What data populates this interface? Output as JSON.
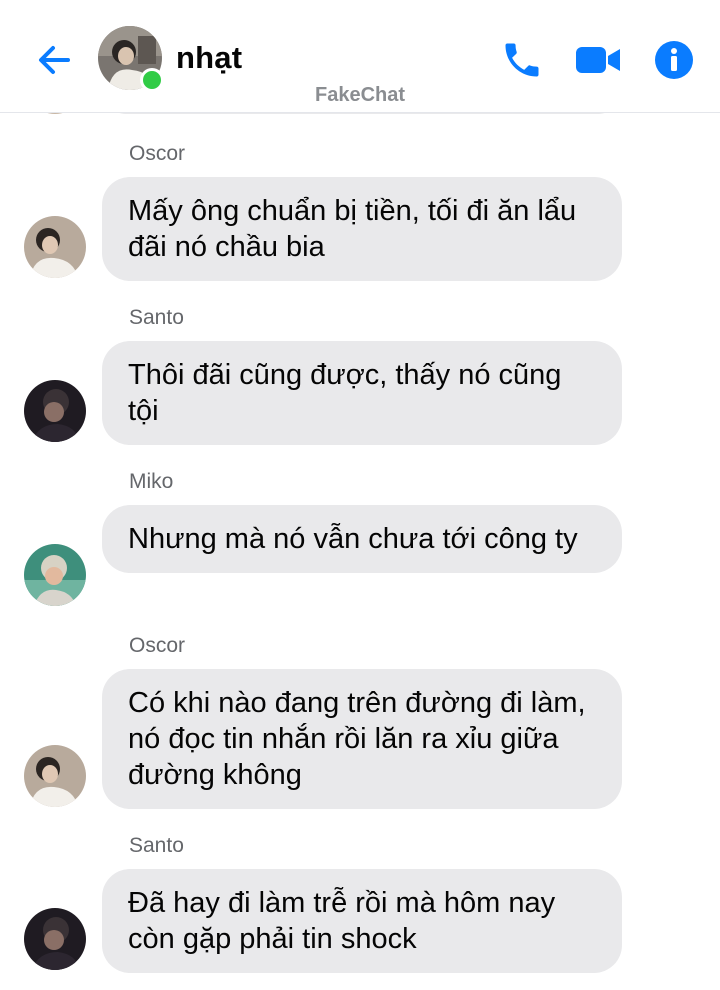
{
  "header": {
    "contact_name": "nhạt",
    "back_icon": "back-arrow-icon",
    "actions": [
      "phone-icon",
      "video-camera-icon",
      "info-icon"
    ],
    "accent_color": "#0a7cff"
  },
  "watermark": "FakeChat",
  "messages": [
    {
      "sender": "Oscor",
      "text": "Mấy ông chuẩn bị tiền,  tối đi ăn lẩu đãi nó chầu bia"
    },
    {
      "sender": "Santo",
      "text": "Thôi đãi cũng được, thấy nó cũng tội"
    },
    {
      "sender": "Miko",
      "text": "Nhưng mà nó vẫn chưa tới công ty"
    },
    {
      "sender": "Oscor",
      "text": "Có khi nào đang trên đường đi làm, nó đọc tin nhắn rồi lăn ra xỉu giữa đường không"
    },
    {
      "sender": "Santo",
      "text": "Đã hay đi làm trễ rồi mà hôm nay còn gặp phải tin shock"
    }
  ]
}
